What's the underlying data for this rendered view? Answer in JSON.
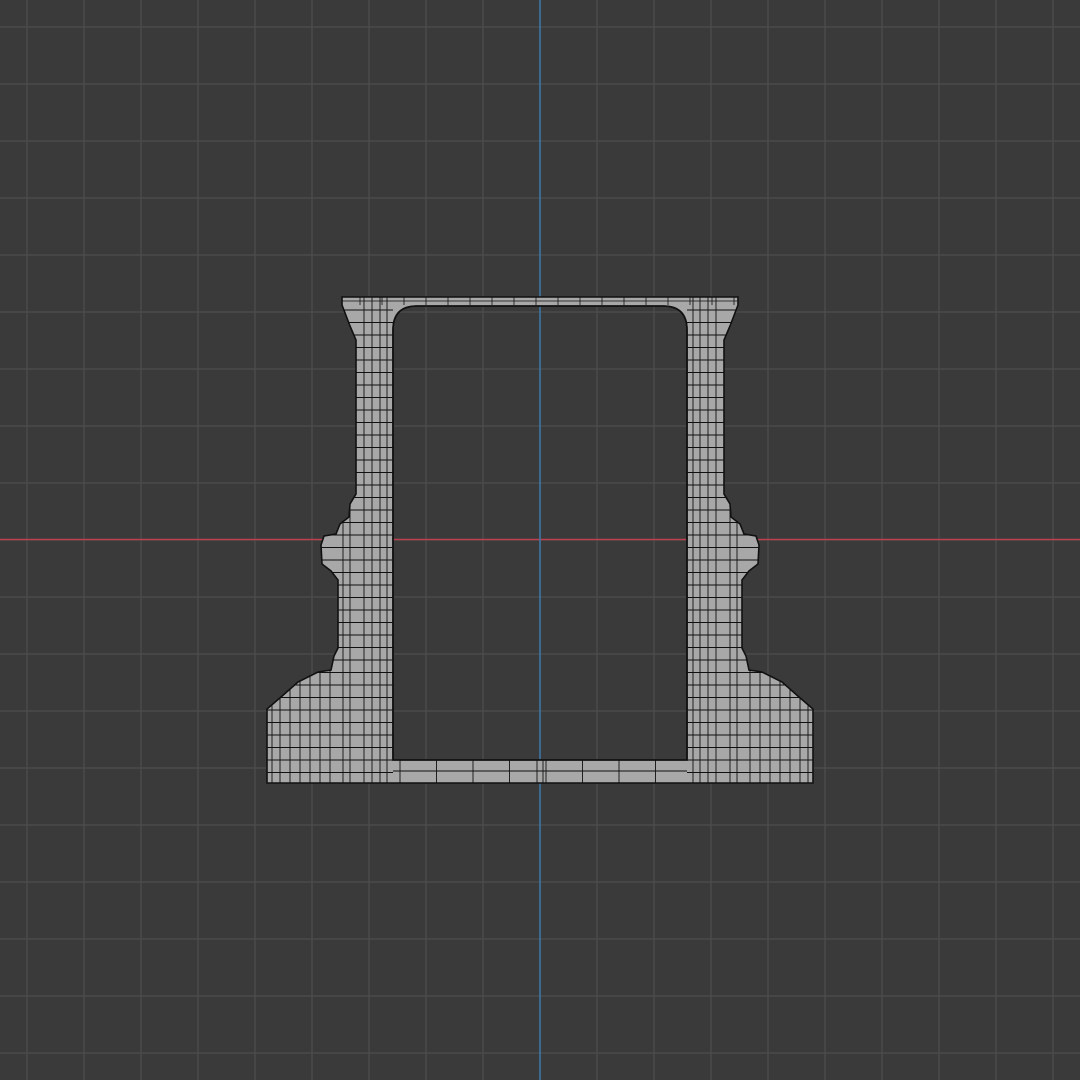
{
  "viewport": {
    "view": "orthographic",
    "colors": {
      "background": "#3a3a3a",
      "grid_line": "#4e4e4e",
      "x_axis": "#b8404f",
      "y_axis": "#3c78a8",
      "mesh_face": "#a8a8a8",
      "mesh_wire": "#111111"
    },
    "object": {
      "shape": "u-channel-cross-section",
      "display_mode": "wireframe-over-solid"
    }
  }
}
